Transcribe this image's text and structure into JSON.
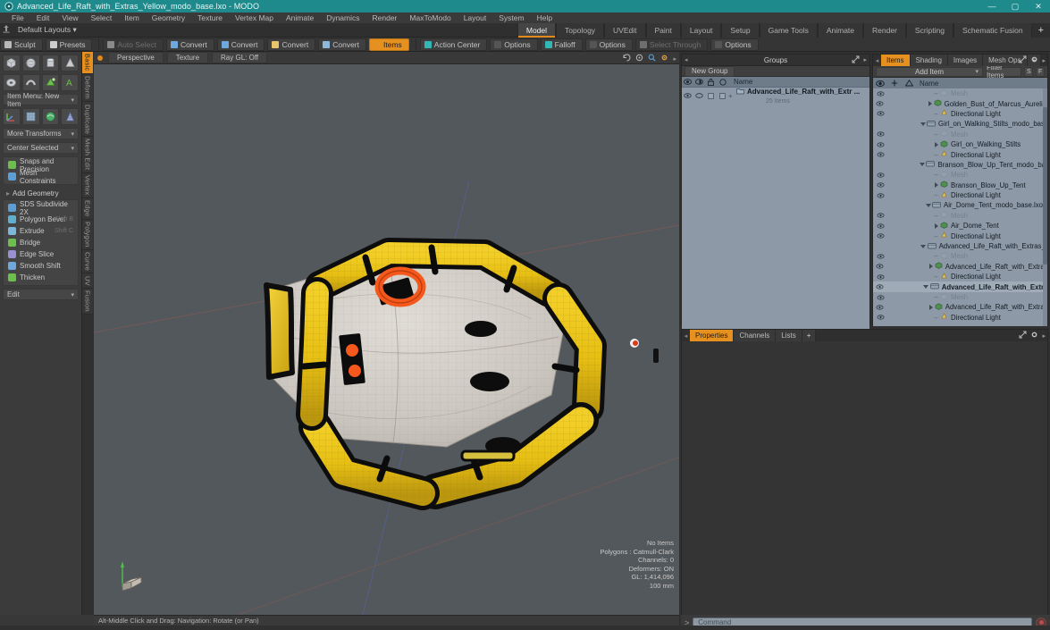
{
  "window": {
    "title": "Advanced_Life_Raft_with_Extras_Yellow_modo_base.lxo - MODO",
    "app_icon": "modo-logo-icon",
    "minimize": "—",
    "maximize": "▢",
    "close": "✕",
    "titlebar_color": "#1f8a8c"
  },
  "menubar": {
    "items": [
      "File",
      "Edit",
      "View",
      "Select",
      "Item",
      "Geometry",
      "Texture",
      "Vertex Map",
      "Animate",
      "Dynamics",
      "Render",
      "MaxToModo",
      "Layout",
      "System",
      "Help"
    ]
  },
  "layoutbar": {
    "anchor_icon": "pin-icon",
    "layouts_label": "Default Layouts",
    "caret": "▾",
    "tabs": [
      {
        "label": "Model",
        "active": true
      },
      {
        "label": "Topology",
        "active": false
      },
      {
        "label": "UVEdit",
        "active": false
      },
      {
        "label": "Paint",
        "active": false
      },
      {
        "label": "Layout",
        "active": false
      },
      {
        "label": "Setup",
        "active": false
      },
      {
        "label": "Game Tools",
        "active": false
      },
      {
        "label": "Animate",
        "active": false
      },
      {
        "label": "Render",
        "active": false
      },
      {
        "label": "Scripting",
        "active": false
      },
      {
        "label": "Schematic Fusion",
        "active": false
      }
    ],
    "add_tab": "+"
  },
  "toolstrip": {
    "left": [
      {
        "label": "Sculpt",
        "icon": "brush-icon",
        "color": "#b9b9b9",
        "state": "normal"
      },
      {
        "label": "Presets",
        "icon": "sphere-icon",
        "color": "#cfcfcf",
        "state": "normal"
      }
    ],
    "middle": [
      {
        "label": "Auto Select",
        "icon": "cube-icon",
        "color": "#8a8a8a",
        "state": "dim"
      },
      {
        "label": "Convert",
        "icon": "convert-vertex-icon",
        "color": "#6fa8dc",
        "state": "normal"
      },
      {
        "label": "Convert",
        "icon": "convert-edge-icon",
        "color": "#6fa8dc",
        "state": "normal"
      },
      {
        "label": "Convert",
        "icon": "convert-polygon-icon",
        "color": "#e8c36b",
        "state": "normal"
      },
      {
        "label": "Convert",
        "icon": "convert-item-icon",
        "color": "#8fb8de",
        "state": "normal"
      },
      {
        "label": "Items",
        "icon": "items-icon",
        "color": "#e6911f",
        "state": "active"
      }
    ],
    "right": [
      {
        "label": "Action Center",
        "icon": "action-center-icon",
        "color": "#35b6b6",
        "state": "normal"
      },
      {
        "label": "Options",
        "icon": "options-icon",
        "color": "#555555",
        "state": "normal"
      },
      {
        "label": "Falloff",
        "icon": "falloff-icon",
        "color": "#35b6b6",
        "state": "normal"
      },
      {
        "label": "Options",
        "icon": "options-icon",
        "color": "#555555",
        "state": "normal"
      },
      {
        "label": "Select Through",
        "icon": "select-through-icon",
        "color": "#6f6f6f",
        "state": "dim"
      },
      {
        "label": "Options",
        "icon": "options-icon",
        "color": "#555555",
        "state": "normal"
      }
    ]
  },
  "left_panel": {
    "vertical_tabs": [
      {
        "label": "Basic",
        "active": true
      },
      {
        "label": "Deform",
        "active": false
      },
      {
        "label": "Duplicate",
        "active": false
      },
      {
        "label": "Mesh Edit",
        "active": false
      },
      {
        "label": "Vertex",
        "active": false
      },
      {
        "label": "Edge",
        "active": false
      },
      {
        "label": "Polygon",
        "active": false
      },
      {
        "label": "Curve",
        "active": false
      },
      {
        "label": "UV",
        "active": false
      },
      {
        "label": "Fusion",
        "active": false
      }
    ],
    "primitives_row1": [
      "cube-primitive-icon",
      "sphere-primitive-icon",
      "cylinder-primitive-icon",
      "cone-primitive-icon"
    ],
    "primitives_row2": [
      "torus-primitive-icon",
      "capsule-primitive-icon",
      "prism-primitive-icon",
      "text-primitive-icon"
    ],
    "item_menu": "Item Menu: New Item",
    "tools_row3": [
      "move-tool-icon",
      "grid-tool-icon",
      "element-move-icon",
      "falloff-tool-icon"
    ],
    "more_transforms": "More Transforms",
    "center_selected": "Center Selected",
    "snaps": {
      "label": "Snaps and Precision",
      "icon": "snap-icon",
      "color": "#6cbf4d"
    },
    "mesh_constraints": {
      "label": "Mesh Constraints",
      "icon": "constraint-icon",
      "color": "#5b9fd6"
    },
    "add_geometry_header": "Add Geometry",
    "geometry_tools": [
      {
        "label": "SDS Subdivide 2X",
        "shortcut": "",
        "icon": "subdivide-icon",
        "color": "#5b9fd6"
      },
      {
        "label": "Polygon Bevel",
        "shortcut": "Shift B",
        "icon": "bevel-icon",
        "color": "#5fb0cf"
      },
      {
        "label": "Extrude",
        "shortcut": "Shift C",
        "icon": "extrude-icon",
        "color": "#7fb7da"
      },
      {
        "label": "Bridge",
        "shortcut": "",
        "icon": "bridge-icon",
        "color": "#6cbf4d"
      },
      {
        "label": "Edge Slice",
        "shortcut": "",
        "icon": "edge-slice-icon",
        "color": "#9a8fd0"
      },
      {
        "label": "Smooth Shift",
        "shortcut": "",
        "icon": "smooth-shift-icon",
        "color": "#6fa8dc"
      },
      {
        "label": "Thicken",
        "shortcut": "",
        "icon": "thicken-icon",
        "color": "#6cbf4d"
      }
    ],
    "edit_dropdown": "Edit"
  },
  "viewport": {
    "dot_icon": "viewport-menu-dot-icon",
    "chips": [
      "Perspective",
      "Texture",
      "Ray GL: Off"
    ],
    "header_icons": [
      "reset-view-icon",
      "rotate-view-icon",
      "zoom-view-icon",
      "magnifier-icon",
      "gear-icon",
      "chevron-right-icon"
    ],
    "stats": [
      "No Items",
      "Polygons : Catmull-Clark",
      "Channels: 0",
      "Deformers: ON",
      "GL: 1,414,096",
      "100 mm"
    ],
    "axis_widget": "axis-gizmo-icon",
    "model": {
      "name": "yellow-life-raft",
      "tube_color": "#e9c01f",
      "tube_shadow": "#b08f16",
      "strap_color": "#111111",
      "floor_color": "#d4d0cb",
      "ring_buoy_color": "#f4581c",
      "background_color": "#53585c"
    }
  },
  "status_bar": {
    "text": "Alt-Middle Click and Drag:   Navigation: Rotate (or Pan)"
  },
  "groups_panel": {
    "title": "Groups",
    "collapse_icon": "chevron-left-icon",
    "expand_icon": "expand-icon",
    "menu_icon": "chevron-right-icon",
    "new_group_button": "New Group",
    "column_icons": [
      "visibility-eye-icon",
      "render-eye-icon",
      "lock-icon",
      "select-icon"
    ],
    "name_header": "Name",
    "rows": [
      {
        "name": "Advanced_Life_Raft_with_Extr ...",
        "sub": "25 Items",
        "icon": "group-folder-icon"
      }
    ]
  },
  "items_panel": {
    "tabs": [
      {
        "label": "Items",
        "active": true
      },
      {
        "label": "Shading",
        "active": false
      },
      {
        "label": "Images",
        "active": false
      },
      {
        "label": "Mesh Ops",
        "active": false
      }
    ],
    "add_tab": "+",
    "expand_icon": "expand-icon",
    "gear_icon": "gear-icon",
    "menu_icon": "chevron-right-icon",
    "add_item_button": "Add Item",
    "add_item_caret": "▾",
    "filter_placeholder": "Filter Items",
    "mini_buttons": [
      "S",
      "F"
    ],
    "column_icons": [
      "visibility-eye-icon",
      "lock-column-icon",
      "shading-column-icon"
    ],
    "name_header": "Name",
    "rows": [
      {
        "indent": 2,
        "label": "Mesh",
        "icon": "mesh-icon",
        "ghost": true,
        "bold": false,
        "tri": "none",
        "eye": true
      },
      {
        "indent": 2,
        "label": "Golden_Bust_of_Marcus_Aurelius_...",
        "icon": "mesh-item-icon",
        "ghost": false,
        "bold": false,
        "tri": "right",
        "eye": true
      },
      {
        "indent": 2,
        "label": "Directional Light",
        "icon": "light-icon",
        "ghost": false,
        "bold": false,
        "tri": "none",
        "eye": true
      },
      {
        "indent": 1,
        "label": "Girl_on_Walking_Stilts_modo_base.lxo",
        "icon": "scene-icon",
        "ghost": false,
        "bold": false,
        "tri": "down",
        "eye": false
      },
      {
        "indent": 2,
        "label": "Mesh",
        "icon": "mesh-icon",
        "ghost": true,
        "bold": false,
        "tri": "none",
        "eye": true
      },
      {
        "indent": 2,
        "label": "Girl_on_Walking_Stilts",
        "icon": "mesh-item-icon",
        "ghost": false,
        "bold": false,
        "tri": "right",
        "eye": true
      },
      {
        "indent": 2,
        "label": "Directional Light",
        "icon": "light-icon",
        "ghost": false,
        "bold": false,
        "tri": "none",
        "eye": true
      },
      {
        "indent": 1,
        "label": "Branson_Blow_Up_Tent_modo_base....",
        "icon": "scene-icon",
        "ghost": false,
        "bold": false,
        "tri": "down",
        "eye": false
      },
      {
        "indent": 2,
        "label": "Mesh",
        "icon": "mesh-icon",
        "ghost": true,
        "bold": false,
        "tri": "none",
        "eye": true
      },
      {
        "indent": 2,
        "label": "Branson_Blow_Up_Tent",
        "icon": "mesh-item-icon",
        "ghost": false,
        "bold": false,
        "tri": "right",
        "eye": true
      },
      {
        "indent": 2,
        "label": "Directional Light",
        "icon": "light-icon",
        "ghost": false,
        "bold": false,
        "tri": "none",
        "eye": true
      },
      {
        "indent": 1,
        "label": "Air_Dome_Tent_modo_base.lxo",
        "icon": "scene-icon",
        "ghost": false,
        "bold": false,
        "tri": "down",
        "eye": false
      },
      {
        "indent": 2,
        "label": "Mesh",
        "icon": "mesh-icon",
        "ghost": true,
        "bold": false,
        "tri": "none",
        "eye": true
      },
      {
        "indent": 2,
        "label": "Air_Dome_Tent",
        "icon": "mesh-item-icon",
        "ghost": false,
        "bold": false,
        "tri": "right",
        "eye": true
      },
      {
        "indent": 2,
        "label": "Directional Light",
        "icon": "light-icon",
        "ghost": false,
        "bold": false,
        "tri": "none",
        "eye": true
      },
      {
        "indent": 1,
        "label": "Advanced_Life_Raft_with_Extras_R ...",
        "icon": "scene-icon",
        "ghost": false,
        "bold": false,
        "tri": "down",
        "eye": false
      },
      {
        "indent": 2,
        "label": "Mesh",
        "icon": "mesh-icon",
        "ghost": true,
        "bold": false,
        "tri": "none",
        "eye": true
      },
      {
        "indent": 2,
        "label": "Advanced_Life_Raft_with_Extras_...",
        "icon": "mesh-item-icon",
        "ghost": false,
        "bold": false,
        "tri": "right",
        "eye": true
      },
      {
        "indent": 2,
        "label": "Directional Light",
        "icon": "light-icon",
        "ghost": false,
        "bold": false,
        "tri": "none",
        "eye": true
      },
      {
        "indent": 1,
        "label": "Advanced_Life_Raft_with_Extr ...",
        "icon": "scene-icon",
        "ghost": false,
        "bold": true,
        "tri": "down",
        "eye": true,
        "selected": true
      },
      {
        "indent": 2,
        "label": "Mesh",
        "icon": "mesh-icon",
        "ghost": true,
        "bold": false,
        "tri": "none",
        "eye": true
      },
      {
        "indent": 2,
        "label": "Advanced_Life_Raft_with_Extras_...",
        "icon": "mesh-item-icon",
        "ghost": false,
        "bold": false,
        "tri": "right",
        "eye": true
      },
      {
        "indent": 2,
        "label": "Directional Light",
        "icon": "light-icon",
        "ghost": false,
        "bold": false,
        "tri": "none",
        "eye": true
      }
    ]
  },
  "properties_panel": {
    "tabs": [
      {
        "label": "Properties",
        "active": true
      },
      {
        "label": "Channels",
        "active": false
      },
      {
        "label": "Lists",
        "active": false
      }
    ],
    "add_tab": "+",
    "expand_icon": "expand-icon",
    "gear_icon": "gear-icon",
    "menu_icon": "chevron-right-icon"
  },
  "command_bar": {
    "prompt": ">",
    "placeholder": "Command",
    "record_icon": "record-icon"
  }
}
